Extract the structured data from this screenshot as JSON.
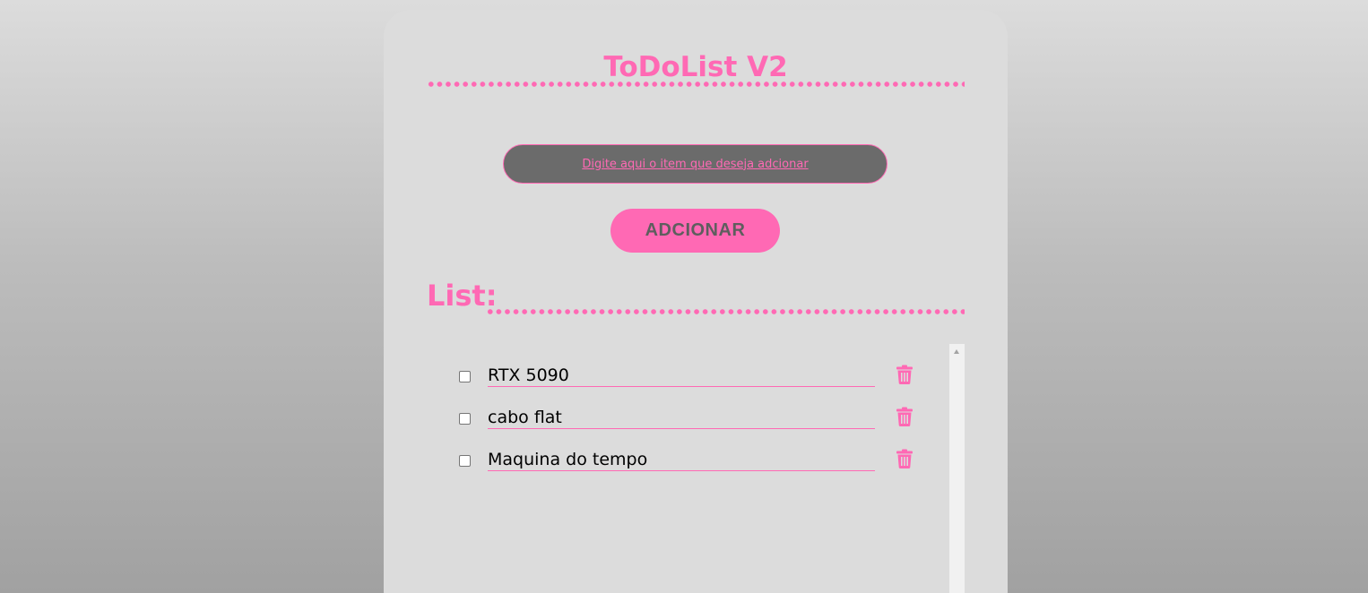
{
  "app": {
    "title": "ToDoList V2"
  },
  "input": {
    "placeholder": "Digite aqui o item que deseja adcionar"
  },
  "add_button": {
    "label": "ADCIONAR"
  },
  "list": {
    "heading": "List:",
    "items": [
      {
        "text": "RTX 5090",
        "checked": false,
        "delete_icon": "trash-icon"
      },
      {
        "text": "cabo flat",
        "checked": false,
        "delete_icon": "trash-icon"
      },
      {
        "text": "Maquina do tempo",
        "checked": false,
        "delete_icon": "trash-icon"
      }
    ]
  },
  "colors": {
    "accent": "#ff69b4",
    "card_background": "#dcdcdc",
    "input_background": "#6b6b6b",
    "button_text": "#5e5e5e"
  }
}
